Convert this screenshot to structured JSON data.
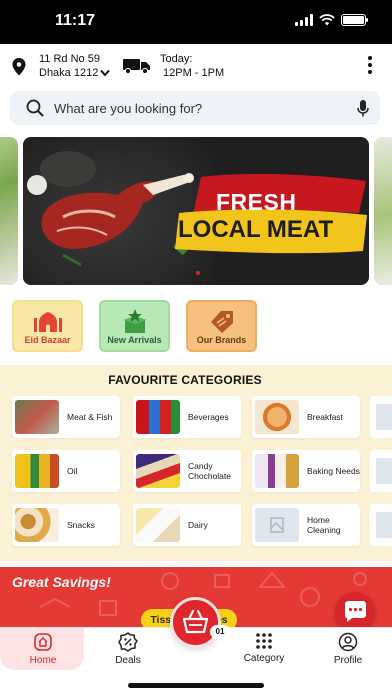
{
  "status_bar": {
    "time": "11:17"
  },
  "header": {
    "address_line1": "11 Rd No 59",
    "address_line2": "Dhaka 1212",
    "delivery_label": "Today:",
    "delivery_time": "12PM - 1PM"
  },
  "search": {
    "placeholder": "What are you looking for?"
  },
  "banner": {
    "line1": "FRESH",
    "line2": "LOCAL MEAT"
  },
  "quick_links": [
    {
      "label": "Eid Bazaar"
    },
    {
      "label": "New Arrivals"
    },
    {
      "label": "Our Brands"
    }
  ],
  "favourite": {
    "title": "FAVOURITE CATEGORIES",
    "items": [
      {
        "label": "Meat & Fish"
      },
      {
        "label": "Beverages"
      },
      {
        "label": "Breakfast"
      },
      {
        "label": "Oil"
      },
      {
        "label": "Candy Chocholate"
      },
      {
        "label": "Baking Needs"
      },
      {
        "label": "Snacks"
      },
      {
        "label": "Dairy"
      },
      {
        "label": "Home Cleaning"
      }
    ]
  },
  "savings": {
    "title": "Great Savings!",
    "chip": "Tissue & Wipes"
  },
  "cart": {
    "count": "01"
  },
  "nav": {
    "home": "Home",
    "deals": "Deals",
    "category": "Category",
    "profile": "Profile"
  },
  "colors": {
    "accent": "#d7262b",
    "search_bg": "#eef3f8",
    "favourite_bg": "#fbf1d4",
    "chip": "#f7d21a"
  }
}
